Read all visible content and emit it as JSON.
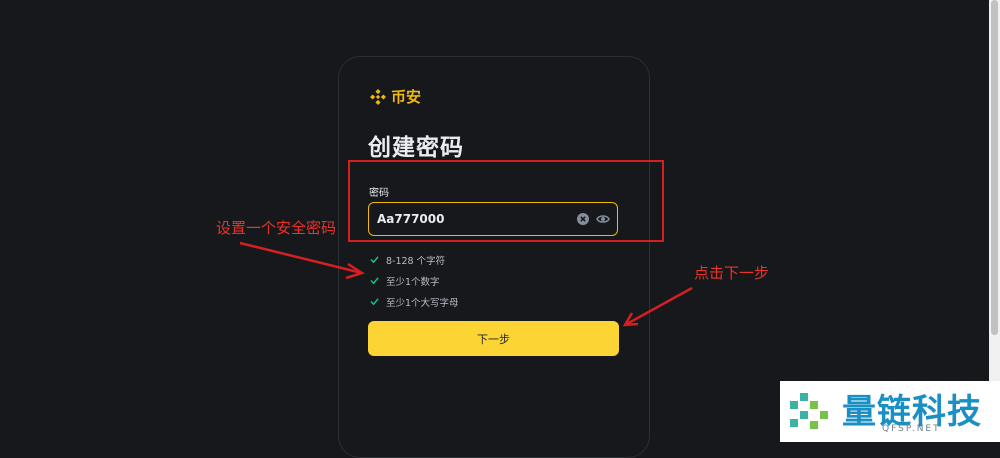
{
  "brand": {
    "name": "币安",
    "icon": "binance-logo-icon"
  },
  "form": {
    "title": "创建密码",
    "password_label": "密码",
    "password_value": "Aa777000",
    "rules": [
      {
        "text": "8-128 个字符",
        "met": true
      },
      {
        "text": "至少1个数字",
        "met": true
      },
      {
        "text": "至少1个大写字母",
        "met": true
      }
    ],
    "next_label": "下一步"
  },
  "annotations": {
    "left": "设置一个安全密码",
    "right": "点击下一步"
  },
  "watermark": {
    "title": "量链科技",
    "subtitle": "QFSP.NET"
  },
  "colors": {
    "background": "#17181c",
    "accent": "#f0b90b",
    "button": "#fcd535",
    "check": "#0ecb81",
    "annotation": "#e8342b"
  }
}
